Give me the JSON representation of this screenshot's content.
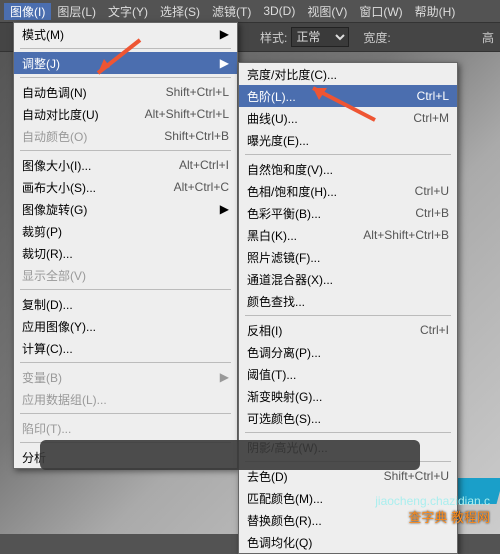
{
  "menubar": {
    "items": [
      "图像(I)",
      "图层(L)",
      "文字(Y)",
      "选择(S)",
      "滤镜(T)",
      "3D(D)",
      "视图(V)",
      "窗口(W)",
      "帮助(H)"
    ],
    "active_index": 0
  },
  "toolbar": {
    "style_label": "样式:",
    "style_value": "正常",
    "width_label": "宽度:",
    "extra": "高"
  },
  "menu1": [
    {
      "label": "模式(M)",
      "arrow": true
    },
    {
      "sep": true
    },
    {
      "label": "调整(J)",
      "arrow": true,
      "hl": true
    },
    {
      "sep": true
    },
    {
      "label": "自动色调(N)",
      "short": "Shift+Ctrl+L"
    },
    {
      "label": "自动对比度(U)",
      "short": "Alt+Shift+Ctrl+L"
    },
    {
      "label": "自动颜色(O)",
      "short": "Shift+Ctrl+B",
      "disabled": true
    },
    {
      "sep": true
    },
    {
      "label": "图像大小(I)...",
      "short": "Alt+Ctrl+I"
    },
    {
      "label": "画布大小(S)...",
      "short": "Alt+Ctrl+C"
    },
    {
      "label": "图像旋转(G)",
      "arrow": true
    },
    {
      "label": "裁剪(P)"
    },
    {
      "label": "裁切(R)..."
    },
    {
      "label": "显示全部(V)",
      "disabled": true
    },
    {
      "sep": true
    },
    {
      "label": "复制(D)..."
    },
    {
      "label": "应用图像(Y)..."
    },
    {
      "label": "计算(C)..."
    },
    {
      "sep": true
    },
    {
      "label": "变量(B)",
      "arrow": true,
      "disabled": true
    },
    {
      "label": "应用数据组(L)...",
      "disabled": true
    },
    {
      "sep": true
    },
    {
      "label": "陷印(T)...",
      "disabled": true
    },
    {
      "sep": true
    },
    {
      "label": "分析"
    }
  ],
  "menu2": [
    {
      "label": "亮度/对比度(C)..."
    },
    {
      "label": "色阶(L)...",
      "short": "Ctrl+L",
      "hl": true
    },
    {
      "label": "曲线(U)...",
      "short": "Ctrl+M"
    },
    {
      "label": "曝光度(E)..."
    },
    {
      "sep": true
    },
    {
      "label": "自然饱和度(V)..."
    },
    {
      "label": "色相/饱和度(H)...",
      "short": "Ctrl+U"
    },
    {
      "label": "色彩平衡(B)...",
      "short": "Ctrl+B"
    },
    {
      "label": "黑白(K)...",
      "short": "Alt+Shift+Ctrl+B"
    },
    {
      "label": "照片滤镜(F)..."
    },
    {
      "label": "通道混合器(X)..."
    },
    {
      "label": "颜色查找..."
    },
    {
      "sep": true
    },
    {
      "label": "反相(I)",
      "short": "Ctrl+I"
    },
    {
      "label": "色调分离(P)..."
    },
    {
      "label": "阈值(T)..."
    },
    {
      "label": "渐变映射(G)..."
    },
    {
      "label": "可选颜色(S)..."
    },
    {
      "sep": true
    },
    {
      "label": "阴影/高光(W)..."
    },
    {
      "sep": true
    },
    {
      "label": "去色(D)",
      "short": "Shift+Ctrl+U"
    },
    {
      "label": "匹配颜色(M)..."
    },
    {
      "label": "替换颜色(R)..."
    },
    {
      "label": "色调均化(Q)"
    }
  ],
  "watermark": {
    "line1": "查字典 教程网",
    "line2": "jiaocheng.chazidian.c"
  }
}
